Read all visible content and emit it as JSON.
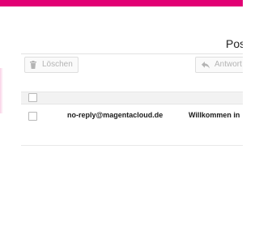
{
  "colors": {
    "brand": "#e20074",
    "button_text": "#b4b4b4",
    "header_bg": "#f2f2f2"
  },
  "page": {
    "title": "Pos"
  },
  "toolbar": {
    "delete": {
      "label": "Löschen",
      "icon": "trash-icon"
    },
    "reply": {
      "label": "Antwort",
      "icon": "reply-icon"
    }
  },
  "messages": [
    {
      "from": "no-reply@magentacloud.de",
      "subject": "Willkommen in"
    }
  ]
}
